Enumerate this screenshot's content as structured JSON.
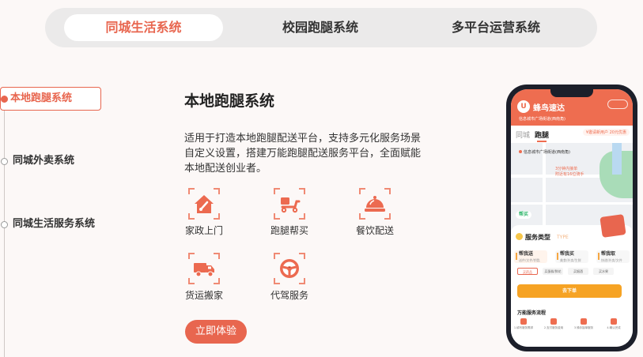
{
  "tabs": [
    {
      "label": "同城生活系统",
      "active": true
    },
    {
      "label": "校园跑腿系统",
      "active": false
    },
    {
      "label": "多平台运营系统",
      "active": false
    }
  ],
  "nav": [
    {
      "label": "本地跑腿系统",
      "active": true
    },
    {
      "label": "同城外卖系统",
      "active": false
    },
    {
      "label": "同城生活服务系统",
      "active": false
    }
  ],
  "content": {
    "title": "本地跑腿系统",
    "description": "适用于打造本地跑腿配送平台，支持多元化服务场景自定义设置，搭建万能跑腿配送服务平台，全面赋能本地配送创业者。",
    "services": [
      {
        "label": "家政上门",
        "icon": "house-icon"
      },
      {
        "label": "跑腿帮买",
        "icon": "scooter-icon"
      },
      {
        "label": "餐饮配送",
        "icon": "food-cloche-icon"
      },
      {
        "label": "货运搬家",
        "icon": "truck-icon"
      },
      {
        "label": "代驾服务",
        "icon": "steering-wheel-icon"
      }
    ],
    "cta": "立即体验"
  },
  "phone": {
    "app_name": "蜂鸟速达",
    "logo_letter": "U",
    "location": "信息城市广场街道(西南角)",
    "tabs": [
      "跑腿",
      "同城"
    ],
    "promo": "¥邀请新用户 20元优惠",
    "map_address": "信息城市广场街道(西南角)",
    "pin_line1": "3分钟内接单",
    "pin_line2": "附近有16位骑手",
    "map_badge": "帮买",
    "service_type_title": "服务类型",
    "service_type_sub": "TYPE",
    "options": [
      {
        "label": "帮我送",
        "sub": "送件/文件/钥匙"
      },
      {
        "label": "帮我买",
        "sub": "美食/外卖/生鲜"
      },
      {
        "label": "帮我取",
        "sub": "快递/外卖/文件"
      }
    ],
    "chips": [
      "买药品",
      "买蛋糕/鲜花",
      "买烟酒",
      "买水果"
    ],
    "order_button": "去下单",
    "flow_title": "万能服务流程",
    "flow_steps": [
      "1.填写服务需求",
      "2.支付服务费用",
      "3.骑手接单服务",
      "4.确认完成"
    ]
  },
  "colors": {
    "accent": "#e8664f",
    "orange": "#f6a324",
    "phone_body": "#1c1f2a"
  }
}
